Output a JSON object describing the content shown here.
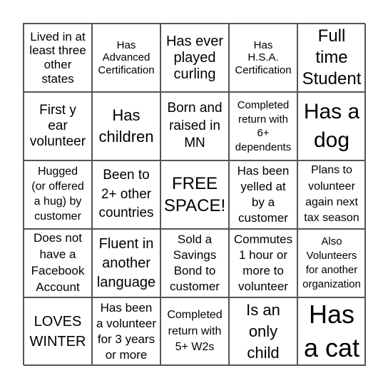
{
  "cells": [
    "Lived in at\nleast three\nother\nstates",
    "Has\nAdvanced\nCertification",
    "Has ever\nplayed\ncurling",
    "Has\nH.S.A.\nCertification",
    "Full\ntime\nStudent",
    "First y\near\nvolunteer",
    "Has\nchildren",
    "Born and\nraised in\nMN",
    "Completed\nreturn with\n6+\ndependents",
    "Has a\ndog",
    "Hugged\n(or offered\na hug) by\ncustomer",
    "Been to\n2+ other\ncountries",
    "FREE\nSPACE!",
    "Has been\nyelled at\nby a\ncustomer",
    "Plans to\nvolunteer\nagain next\ntax season",
    "Does not\nhave a\nFacebook\nAccount",
    "Fluent in\nanother\nlanguage",
    "Sold a\nSavings\nBond to\ncustomer",
    "Commutes\n1 hour or\nmore to\nvolunteer",
    "Also\nVolunteers\nfor another\norganization",
    "LOVES\nWINTER",
    "Has been\na volunteer\nfor 3 years\nor more",
    "Completed\nreturn with\n5+ W2s",
    "Is an\nonly\nchild",
    "Has\na cat"
  ]
}
